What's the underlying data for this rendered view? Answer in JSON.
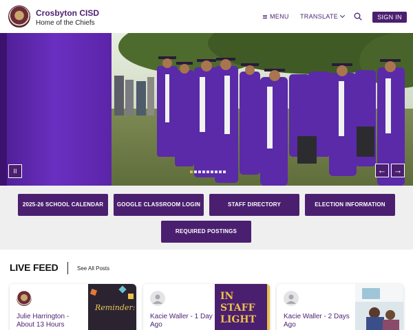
{
  "header": {
    "title": "Crosbyton CISD",
    "subtitle": "Home of the Chiefs",
    "menu_label": "MENU",
    "translate_label": "TRANSLATE",
    "signin_label": "SIGN IN"
  },
  "hero": {
    "pause_label": "II",
    "prev_label": "←",
    "next_label": "→",
    "slide_count": 9,
    "active_slide": 1
  },
  "quick_links": [
    "2025-26 SCHOOL CALENDAR",
    "GOOGLE CLASSROOM LOGIN",
    "STAFF DIRECTORY",
    "ELECTION INFORMATION",
    "REQUIRED POSTINGS"
  ],
  "feed": {
    "title": "LIVE FEED",
    "see_all": "See All Posts",
    "cards": [
      {
        "name": "Julie Harrington - About 13 Hours",
        "image_text": "Reminder:"
      },
      {
        "name": "Kacie Waller - 1 Day Ago",
        "image_text": "IN STAFF LIGHT"
      },
      {
        "name": "Kacie Waller - 2 Days Ago",
        "image_text": ""
      }
    ]
  },
  "colors": {
    "brand_purple": "#4b1f6f",
    "gown_purple": "#5a2aa8",
    "quick_bg": "#efefef"
  }
}
